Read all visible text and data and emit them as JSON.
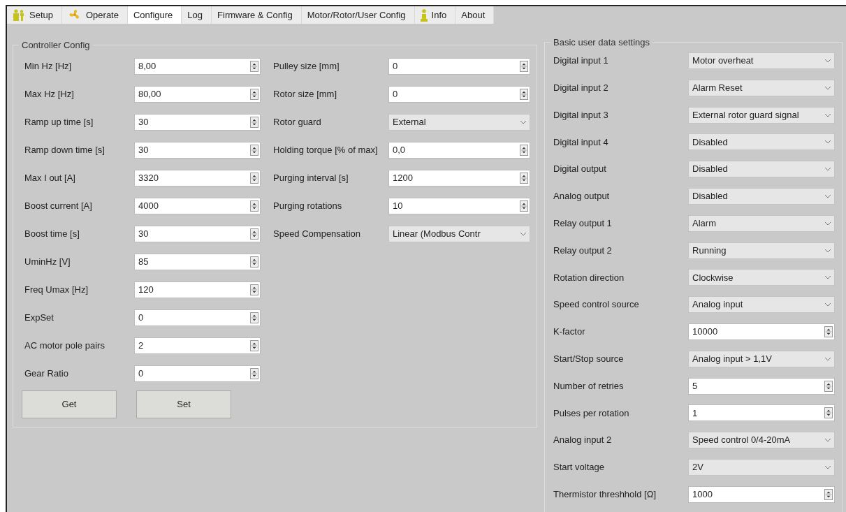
{
  "tabs": [
    {
      "label": "Setup",
      "kind": "figure",
      "selected": false
    },
    {
      "label": "Operate",
      "kind": "fan",
      "selected": false
    },
    {
      "label": "Configure",
      "kind": "plain",
      "selected": true
    },
    {
      "label": "Log",
      "kind": "plain",
      "selected": false
    },
    {
      "label": "Firmware & Config",
      "kind": "plain",
      "selected": false
    },
    {
      "label": "Motor/Rotor/User Config",
      "kind": "plain",
      "selected": false
    },
    {
      "label": "Info",
      "kind": "info",
      "selected": false
    },
    {
      "label": "About",
      "kind": "plain",
      "selected": false
    }
  ],
  "controller_config": {
    "title": "Controller Config",
    "column_1": [
      {
        "label": "Min Hz [Hz]",
        "kind": "spin",
        "value": "8,00"
      },
      {
        "label": "Max Hz [Hz]",
        "kind": "spin",
        "value": "80,00"
      },
      {
        "label": "Ramp up time [s]",
        "kind": "spin",
        "value": "30"
      },
      {
        "label": "Ramp down time [s]",
        "kind": "spin",
        "value": "30"
      },
      {
        "label": "Max I out [A]",
        "kind": "spin",
        "value": "3320"
      },
      {
        "label": "Boost current [A]",
        "kind": "spin",
        "value": "4000"
      },
      {
        "label": "Boost time [s]",
        "kind": "spin",
        "value": "30"
      },
      {
        "label": "UminHz [V]",
        "kind": "spin",
        "value": "85"
      },
      {
        "label": "Freq Umax [Hz]",
        "kind": "spin",
        "value": "120"
      },
      {
        "label": "ExpSet",
        "kind": "spin",
        "value": "0"
      },
      {
        "label": "AC motor pole pairs",
        "kind": "spin",
        "value": "2"
      },
      {
        "label": "Gear Ratio",
        "kind": "spin",
        "value": "0"
      }
    ],
    "column_2": [
      {
        "label": "Pulley size [mm]",
        "kind": "spin",
        "value": "0"
      },
      {
        "label": "Rotor size [mm]",
        "kind": "spin",
        "value": "0"
      },
      {
        "label": "Rotor guard",
        "kind": "combo",
        "value": "External"
      },
      {
        "label": "Holding torque [% of max]",
        "kind": "spin",
        "value": "0,0"
      },
      {
        "label": "Purging interval [s]",
        "kind": "spin",
        "value": "1200"
      },
      {
        "label": "Purging rotations",
        "kind": "spin",
        "value": "10"
      },
      {
        "label": "Speed Compensation",
        "kind": "combo",
        "value": "Linear (Modbus Contr"
      }
    ],
    "buttons": [
      "Get",
      "Set"
    ]
  },
  "basic_user_data_settings": {
    "title": "Basic user data settings",
    "fields": [
      {
        "label": "Digital input 1",
        "kind": "combo",
        "value": "Motor overheat"
      },
      {
        "label": "Digital input 2",
        "kind": "combo",
        "value": "Alarm Reset"
      },
      {
        "label": "Digital input 3",
        "kind": "combo",
        "value": "External rotor guard signal"
      },
      {
        "label": "Digital input 4",
        "kind": "combo",
        "value": "Disabled"
      },
      {
        "label": "Digital output",
        "kind": "combo",
        "value": "Disabled"
      },
      {
        "label": "Analog output",
        "kind": "combo",
        "value": "Disabled"
      },
      {
        "label": "Relay output 1",
        "kind": "combo",
        "value": "Alarm"
      },
      {
        "label": "Relay output 2",
        "kind": "combo",
        "value": "Running"
      },
      {
        "label": "Rotation direction",
        "kind": "combo",
        "value": "Clockwise"
      },
      {
        "label": "Speed control source",
        "kind": "combo",
        "value": "Analog input"
      },
      {
        "label": "K-factor",
        "kind": "spin",
        "value": "10000"
      },
      {
        "label": "Start/Stop source",
        "kind": "combo",
        "value": "Analog input > 1,1V"
      },
      {
        "label": "Number of retries",
        "kind": "spin",
        "value": "5"
      },
      {
        "label": "Pulses per rotation",
        "kind": "spin",
        "value": "1"
      },
      {
        "label": "Analog input 2",
        "kind": "combo",
        "value": "Speed control 0/4-20mA"
      },
      {
        "label": "Start voltage",
        "kind": "combo",
        "value": "2V"
      },
      {
        "label": "Thermistor threshhold [Ω]",
        "kind": "spin",
        "value": "1000"
      }
    ]
  }
}
